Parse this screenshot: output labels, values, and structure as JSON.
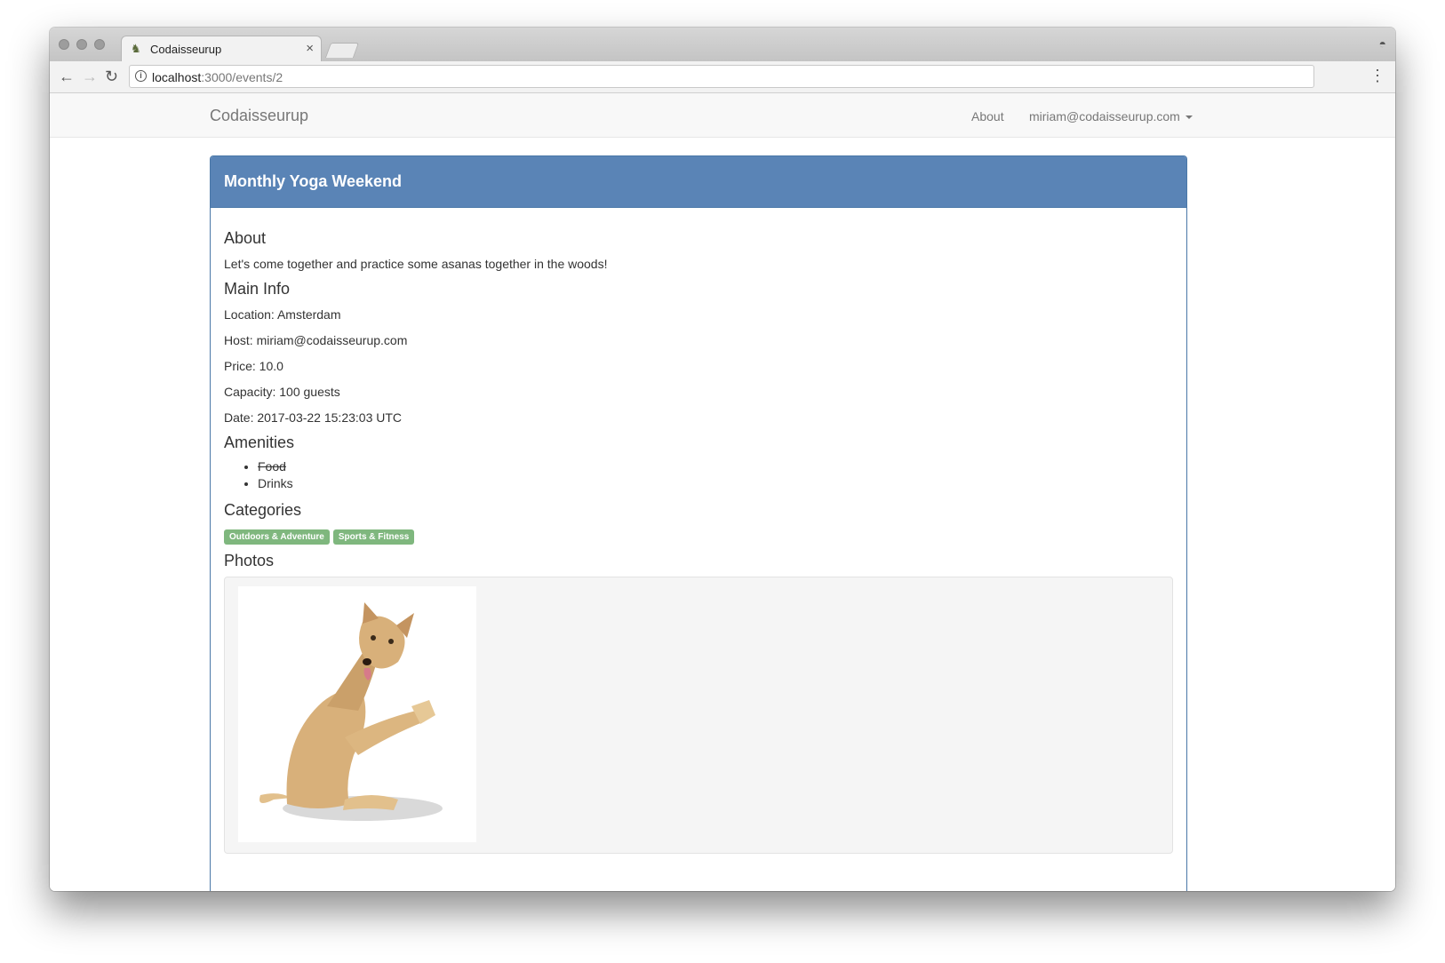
{
  "browser": {
    "tab_title": "Codaisseurup",
    "tab_close": "×",
    "url_host": "localhost",
    "url_path": ":3000/events/2"
  },
  "navbar": {
    "brand": "Codaisseurup",
    "about": "About",
    "user": "miriam@codaisseurup.com"
  },
  "event": {
    "title": "Monthly Yoga Weekend",
    "about_heading": "About",
    "description": "Let's come together and practice some asanas together in the woods!",
    "main_info_heading": "Main Info",
    "location": "Location: Amsterdam",
    "host": "Host: miriam@codaisseurup.com",
    "price": "Price: 10.0",
    "capacity": "Capacity: 100 guests",
    "date": "Date: 2017-03-22 15:23:03 UTC",
    "amenities_heading": "Amenities",
    "amenities": [
      {
        "label": "Food",
        "available": false
      },
      {
        "label": "Drinks",
        "available": true
      }
    ],
    "categories_heading": "Categories",
    "categories": [
      "Outdoors & Adventure",
      "Sports & Fitness"
    ],
    "photos_heading": "Photos"
  },
  "colors": {
    "panel_heading": "#5a84b6",
    "category_label": "#7fb77e"
  }
}
